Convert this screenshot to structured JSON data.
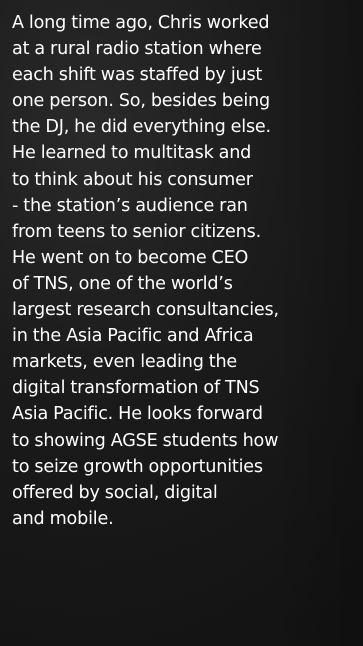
{
  "bio": {
    "lines": [
      "A long time ago, Chris worked",
      "at a rural radio station where",
      "each shift was staffed by just",
      "one person. So, besides being",
      "the DJ, he did everything else.",
      "He learned to multitask and",
      "to think about his consumer",
      "- the station’s audience ran",
      "from teens to senior citizens.",
      "He went on to become CEO",
      "of TNS, one of the world’s",
      "largest research consultancies,",
      "in the Asia Pacific and Africa",
      "markets, even leading the",
      "digital transformation of TNS",
      "Asia Pacific. He looks forward",
      "to showing AGSE students how",
      "to seize growth opportunities",
      "offered by social, digital",
      "and mobile."
    ]
  },
  "colors": {
    "text": "#ffffff",
    "background": "#1b1b1b"
  }
}
